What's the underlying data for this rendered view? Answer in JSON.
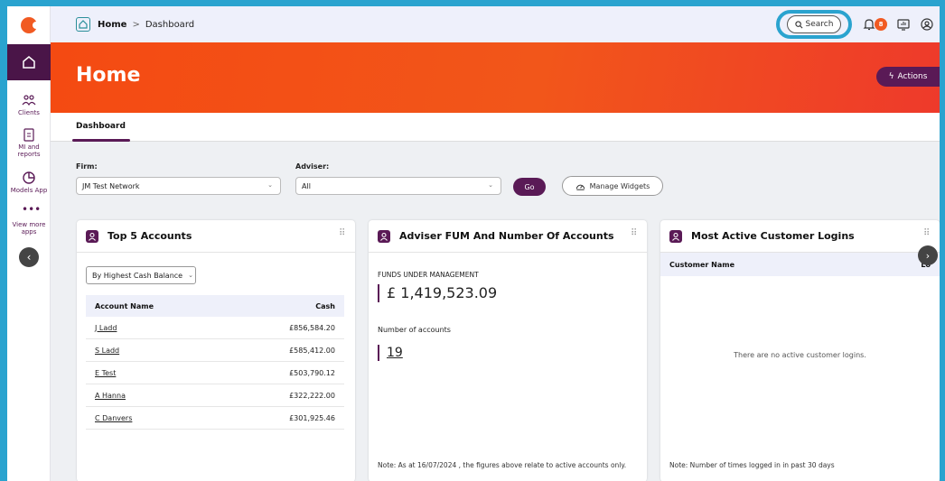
{
  "rail": {
    "items": [
      {
        "label": "Clients"
      },
      {
        "label": "MI and reports"
      },
      {
        "label": "Models App"
      },
      {
        "label": "View more apps"
      }
    ]
  },
  "topbar": {
    "crumb_home": "Home",
    "crumb_sep": ">",
    "crumb_current": "Dashboard",
    "search_label": "Search",
    "notification_count": "8"
  },
  "hero": {
    "title": "Home",
    "actions_label": "Actions"
  },
  "tabs": [
    {
      "label": "Dashboard"
    }
  ],
  "filters": {
    "firm_label": "Firm:",
    "firm_value": "JM Test Network",
    "adviser_label": "Adviser:",
    "adviser_value": "All",
    "go_label": "Go",
    "manage_label": "Manage Widgets"
  },
  "top_accounts": {
    "title": "Top 5 Accounts",
    "sort_value": "By Highest Cash Balance",
    "col_name": "Account Name",
    "col_cash": "Cash",
    "rows": [
      {
        "name": "J Ladd",
        "cash": "£856,584.20"
      },
      {
        "name": "S Ladd",
        "cash": "£585,412.00"
      },
      {
        "name": "E Test",
        "cash": "£503,790.12"
      },
      {
        "name": "A Hanna",
        "cash": "£322,222.00"
      },
      {
        "name": "C Danvers",
        "cash": "£301,925.46"
      }
    ]
  },
  "fum": {
    "title": "Adviser FUM And Number Of Accounts",
    "fum_label": "FUNDS UNDER MANAGEMENT",
    "fum_value": "£ 1,419,523.09",
    "accounts_label": "Number of accounts",
    "accounts_value": "19",
    "note": "Note: As at 16/07/2024 , the figures above relate to active accounts only."
  },
  "logins": {
    "title": "Most Active Customer Logins",
    "col_name": "Customer Name",
    "col_logins": "Lo",
    "empty": "There are no active customer logins.",
    "note": "Note: Number of times logged in in past 30 days"
  },
  "colors": {
    "brand_purple": "#5a1a56",
    "brand_orange": "#f15a22",
    "highlight": "#2aa3cf"
  }
}
